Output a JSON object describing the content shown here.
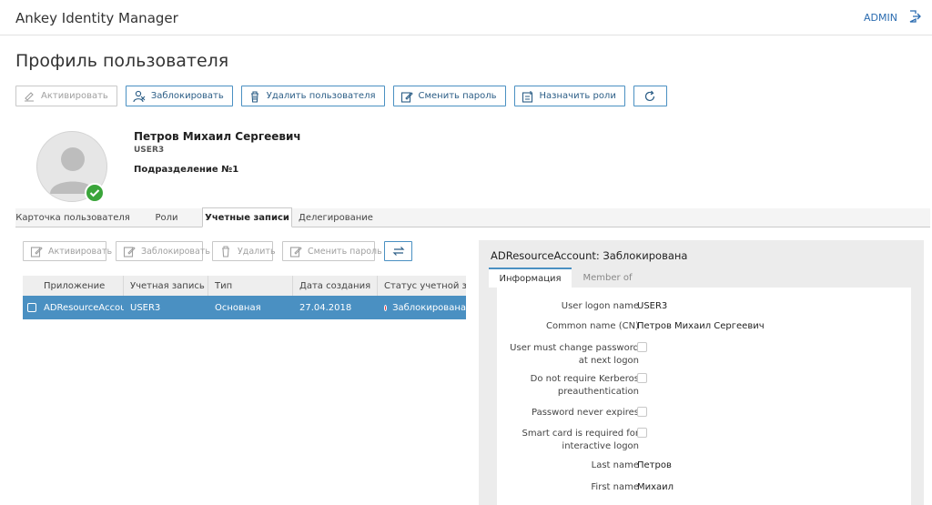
{
  "header": {
    "app_title": "Ankey Identity Manager",
    "user": "ADMIN"
  },
  "page": {
    "title": "Профиль пользователя"
  },
  "toolbar": {
    "activate": "Активировать",
    "block": "Заблокировать",
    "delete_user": "Удалить пользователя",
    "change_password": "Сменить пароль",
    "assign_roles": "Назначить роли"
  },
  "profile": {
    "name": "Петров Михаил Сергеевич",
    "login": "USER3",
    "department": "Подразделение №1"
  },
  "tabs": [
    "Карточка пользователя",
    "Роли",
    "Учетные записи",
    "Делегирование"
  ],
  "accounts_toolbar": {
    "activate": "Активировать",
    "block": "Заблокировать",
    "delete": "Удалить",
    "change_password": "Сменить пароль"
  },
  "grid": {
    "columns": [
      "Приложение",
      "Учетная запись",
      "Тип",
      "Дата создания",
      "Статус учетной за..."
    ],
    "rows": [
      {
        "application": "ADResourceAccou...",
        "account": "USER3",
        "type": "Основная",
        "created": "27.04.2018",
        "status": "Заблокирована"
      }
    ]
  },
  "details": {
    "title": "ADResourceAccount: Заблокирована",
    "tabs": [
      "Информация",
      "Member of"
    ],
    "fields": [
      {
        "label": "User logon name",
        "value": "USER3"
      },
      {
        "label": "Common name (CN)",
        "value": "Петров Михаил Сергеевич"
      },
      {
        "label_line1": "User must change password",
        "label_line2": "at next logon",
        "checked": false
      },
      {
        "label_line1": "Do not require Kerberos",
        "label_line2": "preauthentication",
        "checked": false
      },
      {
        "label": "Password never expires",
        "checked": false
      },
      {
        "label_line1": "Smart card is required for",
        "label_line2": "interactive logon",
        "checked": false
      },
      {
        "label": "Last name",
        "value": "Петров"
      },
      {
        "label": "First name",
        "value": "Михаил"
      }
    ]
  },
  "colors": {
    "accent": "#4a90c2",
    "status_blocked": "#e33333",
    "status_ok": "#3aa53a"
  }
}
